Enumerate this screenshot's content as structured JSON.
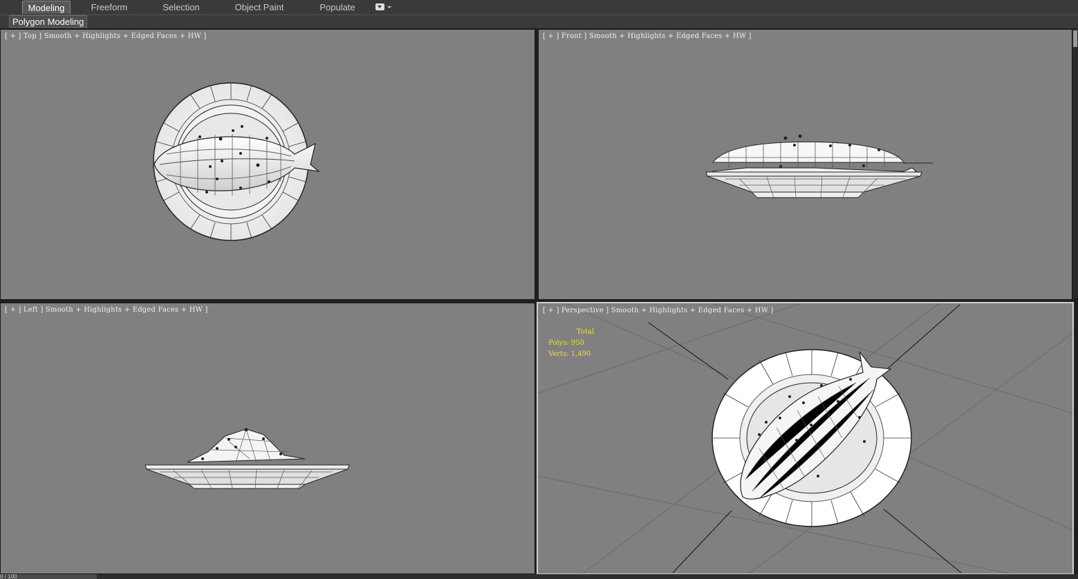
{
  "ribbon": {
    "tabs": [
      "Modeling",
      "Freeform",
      "Selection",
      "Object Paint",
      "Populate"
    ],
    "active_tab": "Modeling",
    "sub_tab": "Polygon Modeling"
  },
  "viewports": {
    "top": {
      "label": "[ + ] Top ] Smooth + Highlights + Edged Faces + HW ]"
    },
    "front": {
      "label": "[ + ] Front ] Smooth + Highlights + Edged Faces + HW ]"
    },
    "left": {
      "label": "[ + ] Left ] Smooth + Highlights + Edged Faces + HW ]"
    },
    "perspective": {
      "label": "[ + ] Perspective ] Smooth + Highlights + Edged Faces + HW ]"
    }
  },
  "stats": {
    "title": "Total",
    "polys": "Polys: 950",
    "verts": "Verts: 1,490"
  },
  "time_slider": {
    "text": "0 / 100"
  },
  "colors": {
    "viewport_bg": "#808080",
    "ui_bg": "#3a3a3a",
    "stats_text": "#f0e030",
    "active_border": "#d0d0d0"
  }
}
